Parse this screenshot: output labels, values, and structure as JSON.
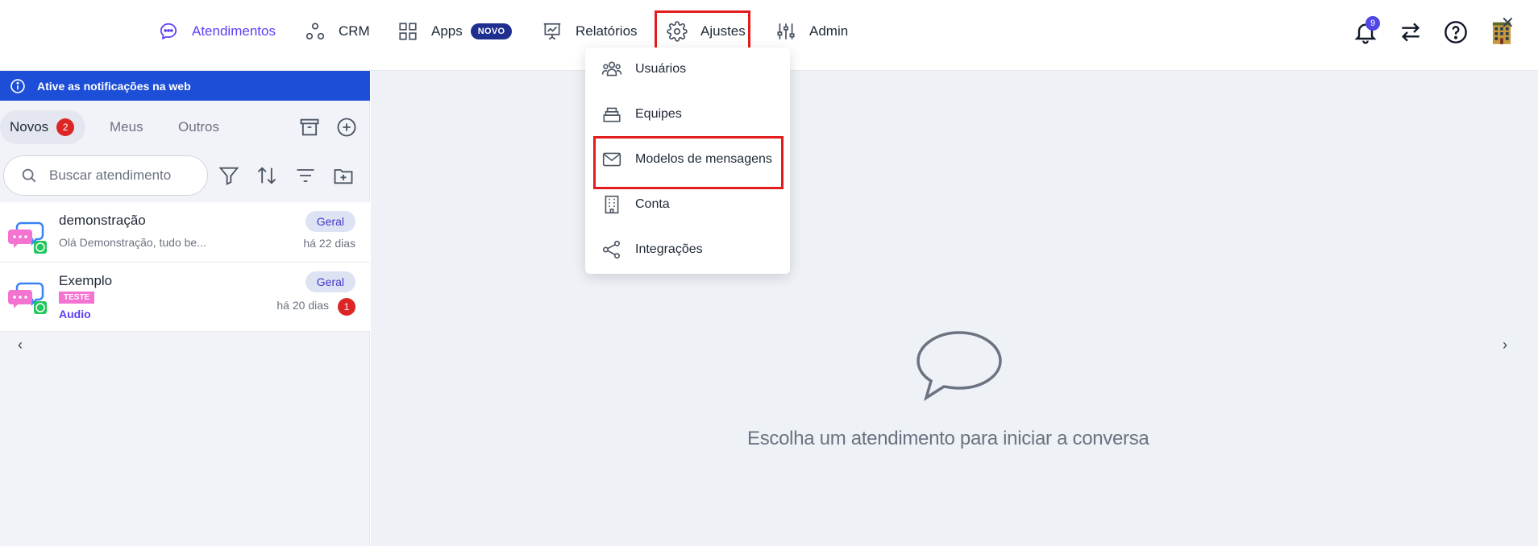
{
  "nav": {
    "atendimentos": "Atendimentos",
    "crm": "CRM",
    "apps": "Apps",
    "apps_badge": "NOVO",
    "relatorios": "Relatórios",
    "ajustes": "Ajustes",
    "admin": "Admin"
  },
  "notifications": {
    "count": "9"
  },
  "close_label": "✕",
  "banner": {
    "text": "Ative as notificações na web"
  },
  "tabs": {
    "novos": "Novos",
    "novos_count": "2",
    "meus": "Meus",
    "outros": "Outros"
  },
  "search": {
    "placeholder": "Buscar atendimento"
  },
  "conversations": [
    {
      "name": "demonstração",
      "preview": "Olá Demonstração, tudo be...",
      "tag": "Geral",
      "time": "há 22 dias"
    },
    {
      "name": "Exemplo",
      "label": "TESTE",
      "preview": "Audio",
      "tag": "Geral",
      "time": "há 20 dias",
      "unread": "1"
    }
  ],
  "pager": {
    "prev": "‹",
    "next": "›"
  },
  "empty_state": {
    "text": "Escolha um atendimento para iniciar a conversa"
  },
  "dropdown": {
    "items": [
      {
        "label": "Usuários",
        "icon": "users-icon"
      },
      {
        "label": "Equipes",
        "icon": "layers-icon"
      },
      {
        "label": "Modelos de mensagens",
        "icon": "mail-icon"
      },
      {
        "label": "Conta",
        "icon": "building-icon"
      },
      {
        "label": "Integrações",
        "icon": "share-icon"
      }
    ]
  },
  "colors": {
    "accent": "#5b3df5",
    "banner": "#1d4ed8",
    "highlight": "#e11d1d",
    "badge_red": "#dc2626",
    "tag_teste": "#f472d0",
    "main_bg": "#eef1f6"
  }
}
